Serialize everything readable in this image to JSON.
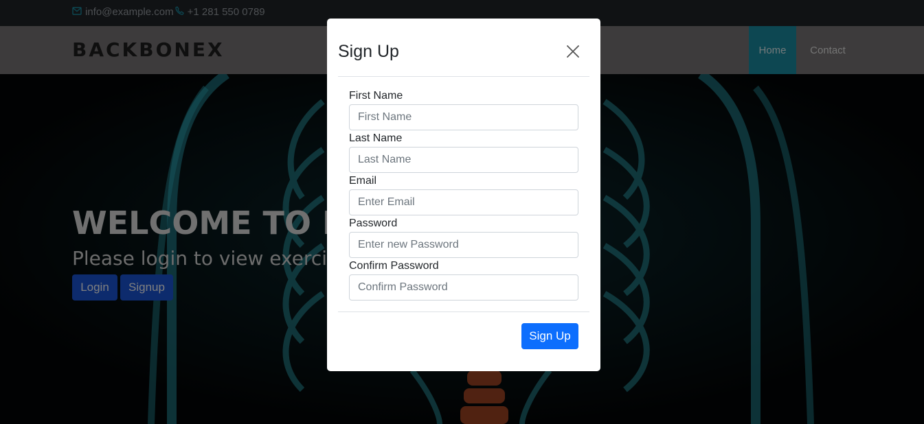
{
  "topbar": {
    "email": "info@example.com",
    "phone": "+1 281 550 0789",
    "email_icon": "mail-icon",
    "phone_icon": "phone-icon"
  },
  "navbar": {
    "brand": "BACKBONEX",
    "items": [
      {
        "label": "Home",
        "active": true
      },
      {
        "label": "Contact",
        "active": false
      }
    ],
    "active_color": "#1a8fa5"
  },
  "hero": {
    "title": "WELCOME TO BA",
    "subtitle": "Please login to view exercise",
    "login_label": "Login",
    "signup_label": "Signup",
    "button_color": "#1a56db"
  },
  "modal": {
    "title": "Sign Up",
    "close_icon": "close-icon",
    "fields": [
      {
        "label": "First Name",
        "placeholder": "First Name",
        "value": ""
      },
      {
        "label": "Last Name",
        "placeholder": "Last Name",
        "value": ""
      },
      {
        "label": "Email",
        "placeholder": "Enter Email",
        "value": ""
      },
      {
        "label": "Password",
        "placeholder": "Enter new Password",
        "value": ""
      },
      {
        "label": "Confirm Password",
        "placeholder": "Confirm Password",
        "value": ""
      }
    ],
    "submit_label": "Sign Up",
    "submit_color": "#0d6efd"
  }
}
